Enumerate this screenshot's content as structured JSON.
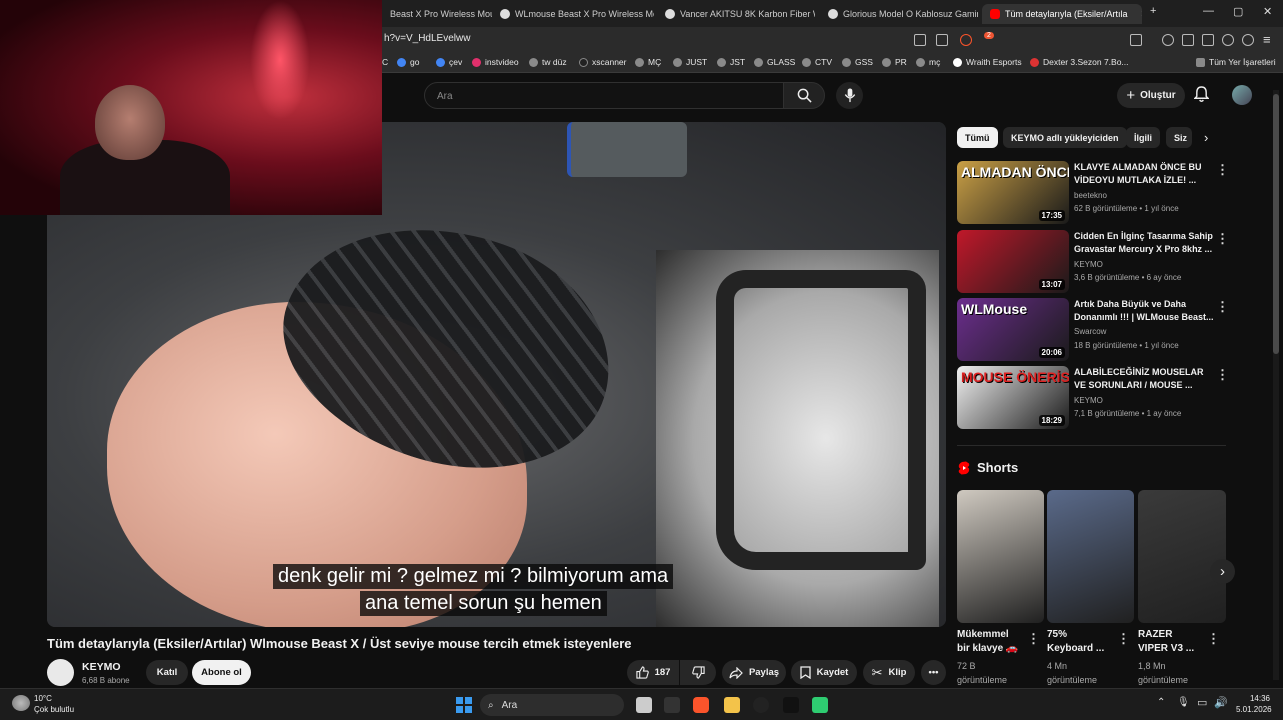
{
  "browser": {
    "tabs": [
      {
        "label": "Beast X Pro Wireless Mou",
        "color": "#e53935"
      },
      {
        "label": "WLmouse Beast X Pro Wireless Mou",
        "color": "#dddddd"
      },
      {
        "label": "Vancer AKITSU 8K Karbon Fiber Wire",
        "color": "#dddddd"
      },
      {
        "label": "Glorious Model O Kablosuz Gaming",
        "color": "#dddddd"
      },
      {
        "label": "Tüm detaylarıyla (Eksiler/Artıla",
        "color": "#ff0000"
      }
    ],
    "url": "h?v=V_HdLEvelww",
    "bookmarks": [
      "C",
      "go",
      "çev",
      "instvideo",
      "tw düz",
      "xscanner",
      "MÇ",
      "JUST",
      "JST",
      "GLASS",
      "CTV",
      "GSS",
      "PR",
      "mç",
      "Wraith Esports",
      "Dexter 3.Sezon 7.Bo...",
      "Tüm Yer İşaretleri"
    ],
    "badge_count": "2"
  },
  "header": {
    "search_placeholder": "Ara",
    "create_label": "Oluştur"
  },
  "video": {
    "subtitle_line1": "denk gelir mi ? gelmez mi ? bilmiyorum ama",
    "subtitle_line2": "ana temel sorun şu hemen",
    "title": "Tüm detaylarıyla (Eksiler/Artılar) Wlmouse Beast X / Üst seviye mouse tercih etmek isteyenlere",
    "channel": "KEYMO",
    "subscribers": "6,68 B abone",
    "join_label": "Katıl",
    "subscribe_label": "Abone ol",
    "likes": "187",
    "share_label": "Paylaş",
    "save_label": "Kaydet",
    "clip_label": "Klip"
  },
  "sidebar": {
    "chips": [
      "Tümü",
      "KEYMO adlı yükleyiciden",
      "İlgili",
      "Siz"
    ],
    "related": [
      {
        "title": "KLAVYE ALMADAN ÖNCE BU VİDEOYU MUTLAKA İZLE! ...",
        "channel": "beetekno",
        "meta": "62 B görüntüleme • 1 yıl önce",
        "duration": "17:35",
        "thumb_text": "ALMADAN ÖNCE!",
        "bg": "#caa046"
      },
      {
        "title": "Cidden En İlginç Tasarıma Sahip Gravastar Mercury X Pro 8khz ...",
        "channel": "KEYMO",
        "meta": "3,6 B görüntüleme • 6 ay önce",
        "duration": "13:07",
        "thumb_text": "",
        "bg": "#c0182a"
      },
      {
        "title": "Artık Daha Büyük ve Daha Donanımlı !!! | WLMouse Beast...",
        "channel": "Swarcow",
        "meta": "18 B görüntüleme • 1 yıl önce",
        "duration": "20:06",
        "thumb_text": "WLMouse",
        "bg": "#6c2e8e"
      },
      {
        "title": "ALABİLECEĞİNİZ MOUSELAR VE SORUNLARI / MOUSE ...",
        "channel": "KEYMO",
        "meta": "7,1 B görüntüleme • 1 ay önce",
        "duration": "18:29",
        "thumb_text": "MOUSE ÖNERİSİ",
        "bg": "#f1f1f1"
      }
    ],
    "shorts_heading": "Shorts",
    "shorts": [
      {
        "title1": "Mükemmel",
        "title2": "bir klavye 🚗",
        "views": "72 B",
        "views_label": "görüntüleme",
        "bg": "#cfc9c0"
      },
      {
        "title1": "75%",
        "title2": "Keyboard ...",
        "views": "4 Mn",
        "views_label": "görüntüleme",
        "bg": "#5a6a8a"
      },
      {
        "title1": "RAZER",
        "title2": "VIPER V3 ...",
        "views": "1,8 Mn",
        "views_label": "görüntüleme",
        "bg": "#3a3a3a"
      }
    ]
  },
  "taskbar": {
    "temp": "10°C",
    "weather": "Çok bulutlu",
    "search_label": "Ara",
    "time": "14:36",
    "date": "5.01.2026"
  }
}
